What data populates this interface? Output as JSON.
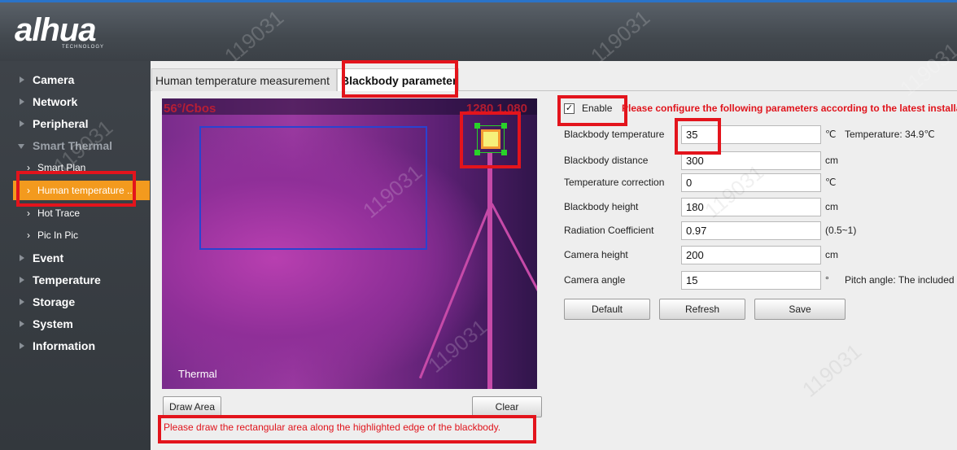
{
  "brand": {
    "logo_text": "alhua",
    "logo_sub": "TECHNOLOGY"
  },
  "sidebar": {
    "items": [
      {
        "label": "Camera"
      },
      {
        "label": "Network"
      },
      {
        "label": "Peripheral"
      },
      {
        "label": "Smart Thermal"
      },
      {
        "label": "Event"
      },
      {
        "label": "Temperature"
      },
      {
        "label": "Storage"
      },
      {
        "label": "System"
      },
      {
        "label": "Information"
      }
    ],
    "subitems": [
      {
        "label": "Smart Plan"
      },
      {
        "label": "Human temperature ..."
      },
      {
        "label": "Hot Trace"
      },
      {
        "label": "Pic In Pic"
      }
    ]
  },
  "tabs": [
    {
      "label": "Human temperature measurement"
    },
    {
      "label": "Blackbody parameter"
    }
  ],
  "video": {
    "overlay_left": "56°/Cbos",
    "overlay_right": "1280 1.080",
    "thermal_label": "Thermal"
  },
  "actions": {
    "draw_area": "Draw Area",
    "clear": "Clear"
  },
  "hint_text": "Please draw the rectangular area along the highlighted edge of the blackbody.",
  "params": {
    "enable_label": "Enable",
    "enabled": true,
    "notice": "Please configure the following parameters according to the latest installat",
    "rows": [
      {
        "label": "Blackbody temperature",
        "value": "35",
        "unit": "℃",
        "extra": "Temperature: 34.9℃"
      },
      {
        "label": "Blackbody distance",
        "value": "300",
        "unit": "cm",
        "extra": ""
      },
      {
        "label": "Temperature correction",
        "value": "0",
        "unit": "℃",
        "extra": ""
      },
      {
        "label": "Blackbody height",
        "value": "180",
        "unit": "cm",
        "extra": ""
      },
      {
        "label": "Radiation Coefficient",
        "value": "0.97",
        "unit": "(0.5~1)",
        "extra": ""
      },
      {
        "label": "Camera height",
        "value": "200",
        "unit": "cm",
        "extra": ""
      },
      {
        "label": "Camera angle",
        "value": "15",
        "unit": "°",
        "extra": "Pitch angle: The included"
      }
    ],
    "buttons": {
      "default": "Default",
      "refresh": "Refresh",
      "save": "Save"
    }
  },
  "watermark": "119031",
  "colors": {
    "active_nav": "#f39a1e",
    "highlight": "#e3141c",
    "notice_text": "#e0141c",
    "draw_rect": "#2943d1"
  }
}
